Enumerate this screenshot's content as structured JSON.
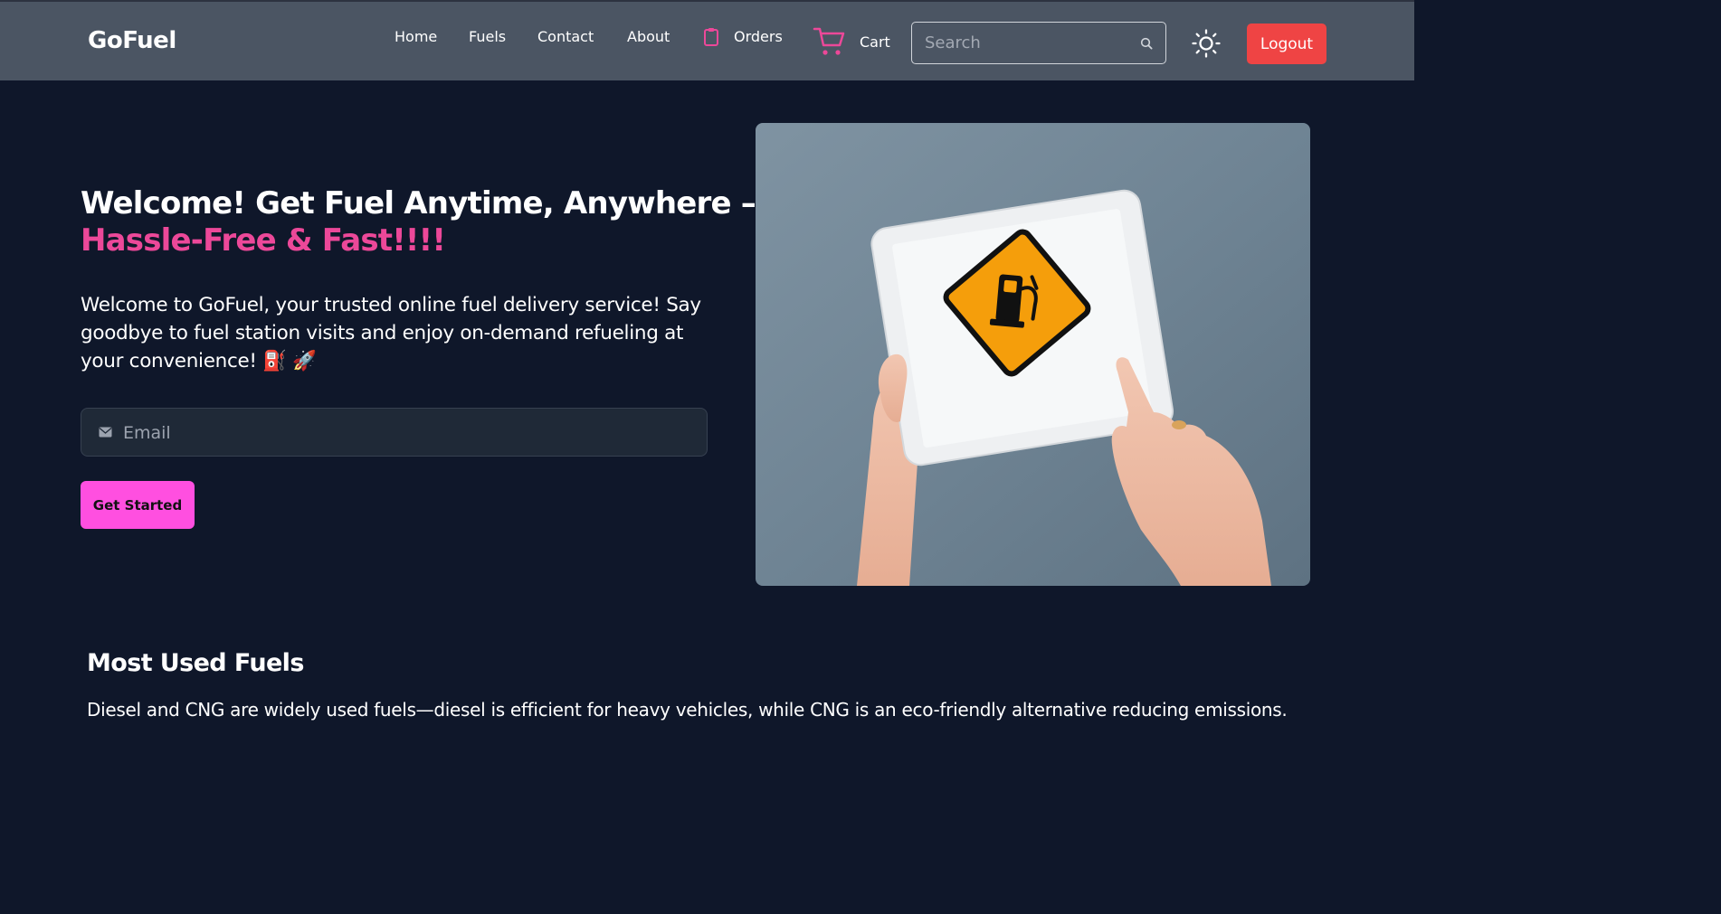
{
  "brand": {
    "name": "GoFuel"
  },
  "nav": {
    "home": "Home",
    "fuels": "Fuels",
    "contact": "Contact",
    "about": "About",
    "orders": "Orders",
    "cart": "Cart"
  },
  "search": {
    "placeholder": "Search"
  },
  "actions": {
    "logout": "Logout"
  },
  "hero": {
    "title_line1": "Welcome! Get Fuel Anytime, Anywhere –",
    "title_line2": "Hassle-Free & Fast!!!!",
    "description": "Welcome to GoFuel, your trusted online fuel delivery service! Say goodbye to fuel station visits and enjoy on-demand refueling at your convenience! ⛽ 🚀",
    "email_placeholder": "Email",
    "cta": "Get Started"
  },
  "section": {
    "title": "Most Used Fuels",
    "description": "Diesel and CNG are widely used fuels—diesel is efficient for heavy vehicles, while CNG is an eco-friendly alternative reducing emissions."
  },
  "colors": {
    "navbar_bg": "#4b5563",
    "page_bg": "#0f172a",
    "accent_pink": "#ec4899",
    "cta_bg": "#ff4fe0",
    "logout_bg": "#ef4444"
  },
  "icons": {
    "orders": "clipboard-icon",
    "cart": "cart-icon",
    "search": "search-icon",
    "theme": "sun-icon",
    "email": "envelope-icon"
  }
}
